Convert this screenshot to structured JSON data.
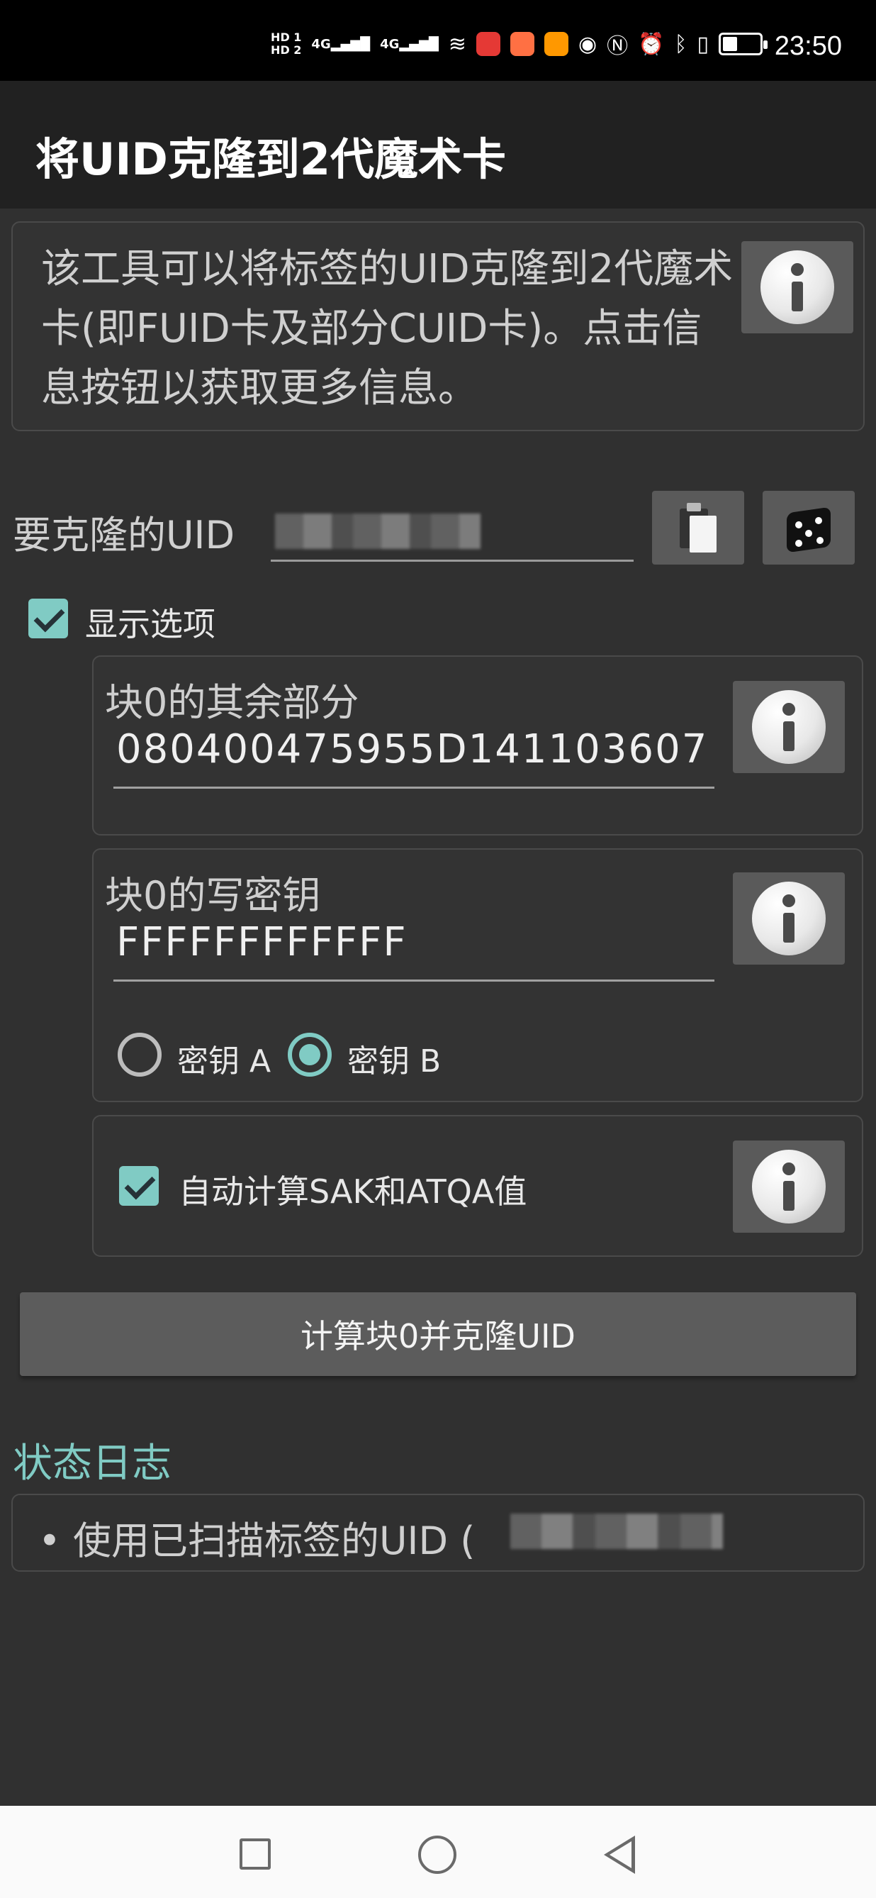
{
  "status_bar": {
    "time": "23:50",
    "network_labels": [
      "HD 1",
      "HD 2",
      "4G",
      "4G"
    ],
    "icons": [
      "signal-icon",
      "signal-icon",
      "wifi-icon",
      "app-notification-icon",
      "app-notification-icon",
      "app-notification-icon",
      "eye-icon",
      "nfc-icon",
      "alarm-icon",
      "bluetooth-icon",
      "vibrate-icon",
      "battery-icon"
    ]
  },
  "appbar": {
    "title": "将UID克隆到2代魔术卡"
  },
  "description": {
    "text": "该工具可以将标签的UID克隆到2代魔术卡(即FUID卡及部分CUID卡)。点击信息按钮以获取更多信息。",
    "info_icon": "info-icon"
  },
  "uid": {
    "label": "要克隆的UID",
    "value": "",
    "paste_icon": "paste-icon",
    "random_icon": "dice-icon"
  },
  "show_options": {
    "label": "显示选项",
    "checked": true
  },
  "block0_rest": {
    "title": "块0的其余部分",
    "value": "080400475955D141103607"
  },
  "block0_key": {
    "title": "块0的写密钥",
    "value": "FFFFFFFFFFFF",
    "key_a_label": "密钥 A",
    "key_b_label": "密钥 B",
    "selected": "密钥 B"
  },
  "auto_calc": {
    "label": "自动计算SAK和ATQA值",
    "checked": true
  },
  "action_button": {
    "label": "计算块0并克隆UID"
  },
  "log": {
    "title": "状态日志",
    "entries": [
      "使用已扫描标签的UID ("
    ]
  },
  "colors": {
    "accent": "#80cbc4",
    "background": "#303030",
    "appbar": "#212121"
  }
}
